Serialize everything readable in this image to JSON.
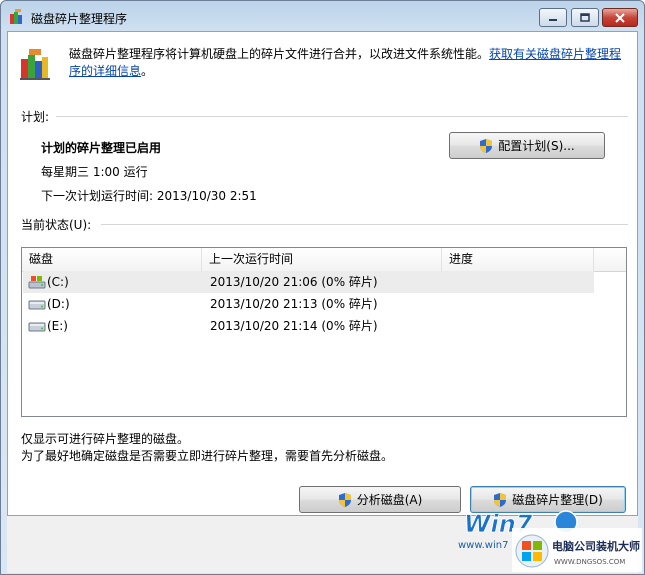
{
  "window": {
    "title": "磁盘碎片整理程序"
  },
  "header": {
    "description": "磁盘碎片整理程序将计算机硬盘上的碎片文件进行合并，以改进文件系统性能。",
    "link_text": "获取有关磁盘碎片整理程序的详细信息",
    "link_suffix": "。"
  },
  "schedule": {
    "section_label": "计划:",
    "status": "计划的碎片整理已启用",
    "frequency": "每星期三  1:00 运行",
    "next_run": "下一次计划运行时间: 2013/10/30 2:51",
    "configure_button": "配置计划(S)..."
  },
  "current_status": {
    "section_label": "当前状态(U):",
    "columns": [
      "磁盘",
      "上一次运行时间",
      "进度"
    ],
    "rows": [
      {
        "disk": "(C:)",
        "last_run": "2013/10/20 21:06 (0% 碎片)",
        "progress": "",
        "icon": "system-drive-icon"
      },
      {
        "disk": "(D:)",
        "last_run": "2013/10/20 21:13 (0% 碎片)",
        "progress": "",
        "icon": "drive-icon"
      },
      {
        "disk": "(E:)",
        "last_run": "2013/10/20 21:14 (0% 碎片)",
        "progress": "",
        "icon": "drive-icon"
      }
    ]
  },
  "notes": {
    "line1": "仅显示可进行碎片整理的磁盘。",
    "line2": "为了最好地确定磁盘是否需要立即进行碎片整理，需要首先分析磁盘。"
  },
  "actions": {
    "analyze_button": "分析磁盘(A)",
    "defrag_button": "磁盘碎片整理(D)"
  },
  "watermark": {
    "brand": "Win7",
    "site": "www.win7",
    "corp_name": "电脑公司装机大师",
    "corp_site": "WWW.DNGSOS.COM"
  },
  "colors": {
    "link": "#0645ad",
    "titlebar": "#bcd3ea",
    "close_button": "#c7463a"
  }
}
